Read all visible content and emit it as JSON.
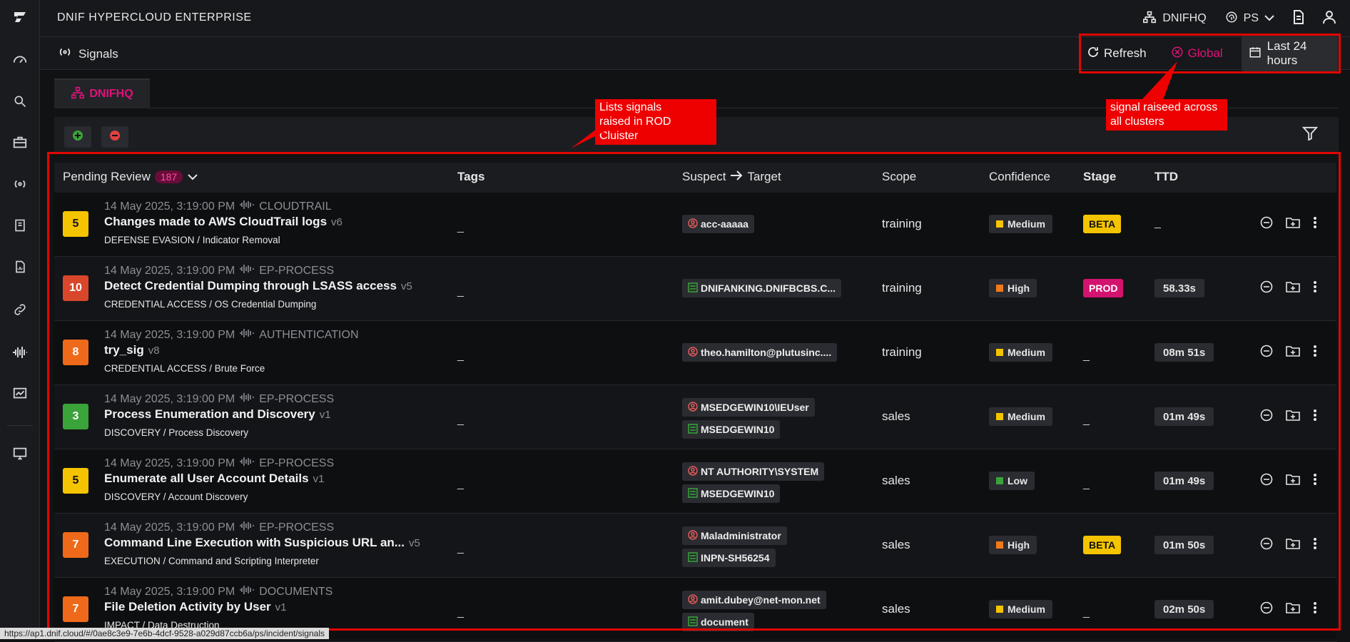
{
  "app": {
    "title": "DNIF HYPERCLOUD ENTERPRISE"
  },
  "topbar": {
    "cluster_label": "DNIFHQ",
    "user_short": "PS"
  },
  "page": {
    "title": "Signals"
  },
  "actions": {
    "refresh": "Refresh",
    "global": "Global",
    "time_range": "Last 24 hours"
  },
  "tabs": [
    {
      "label": "DNIFHQ"
    }
  ],
  "annotations": {
    "cluster_note": "Lists signals\nraised in ROD Cluister",
    "global_note": "signal raiseed across\n all clusters"
  },
  "table": {
    "status_filter": "Pending Review",
    "pending_count": "187",
    "headers": {
      "tags": "Tags",
      "suspect": "Suspect",
      "target": "Target",
      "scope": "Scope",
      "confidence": "Confidence",
      "stage": "Stage",
      "ttd": "TTD"
    },
    "rows": [
      {
        "severity": "5",
        "sev_color": "#f5c400",
        "sev_text": "#111",
        "timestamp": "14 May 2025, 3:19:00 PM",
        "source": "CLOUDTRAIL",
        "name": "Changes made to AWS CloudTrail logs",
        "version": "v6",
        "tactic": "DEFENSE EVASION / Indicator Removal",
        "tags": "_",
        "entities": [
          {
            "type": "user",
            "label": "acc-aaaaa"
          }
        ],
        "scope": "training",
        "confidence": "Medium",
        "conf_color": "#f5c400",
        "stage": "BETA",
        "stage_bg": "#f5c400",
        "stage_fg": "#111",
        "ttd": "_"
      },
      {
        "severity": "10",
        "sev_color": "#d9472b",
        "sev_text": "#fff",
        "timestamp": "14 May 2025, 3:19:00 PM",
        "source": "EP-PROCESS",
        "name": "Detect Credential Dumping through LSASS access",
        "version": "v5",
        "tactic": "CREDENTIAL ACCESS / OS Credential Dumping",
        "tags": "_",
        "entities": [
          {
            "type": "host",
            "label": "DNIFANKING.DNIFBCBS.C..."
          }
        ],
        "scope": "training",
        "confidence": "High",
        "conf_color": "#f07a1a",
        "stage": "PROD",
        "stage_bg": "#d4126f",
        "stage_fg": "#fff",
        "ttd": "58.33s"
      },
      {
        "severity": "8",
        "sev_color": "#ee6a1a",
        "sev_text": "#fff",
        "timestamp": "14 May 2025, 3:19:00 PM",
        "source": "AUTHENTICATION",
        "name": "try_sig",
        "version": "v8",
        "tactic": "CREDENTIAL ACCESS / Brute Force",
        "tags": "_",
        "entities": [
          {
            "type": "user",
            "label": "theo.hamilton@plutusinc...."
          }
        ],
        "scope": "training",
        "confidence": "Medium",
        "conf_color": "#f5c400",
        "stage": "_",
        "stage_bg": "",
        "stage_fg": "#ccc",
        "ttd": "08m 51s"
      },
      {
        "severity": "3",
        "sev_color": "#3aa33a",
        "sev_text": "#fff",
        "timestamp": "14 May 2025, 3:19:00 PM",
        "source": "EP-PROCESS",
        "name": "Process Enumeration and Discovery",
        "version": "v1",
        "tactic": "DISCOVERY / Process Discovery",
        "tags": "_",
        "entities": [
          {
            "type": "user",
            "label": "MSEDGEWIN10\\IEUser"
          },
          {
            "type": "host",
            "label": "MSEDGEWIN10"
          }
        ],
        "scope": "sales",
        "confidence": "Medium",
        "conf_color": "#f5c400",
        "stage": "_",
        "stage_bg": "",
        "stage_fg": "#ccc",
        "ttd": "01m 49s"
      },
      {
        "severity": "5",
        "sev_color": "#f5c400",
        "sev_text": "#111",
        "timestamp": "14 May 2025, 3:19:00 PM",
        "source": "EP-PROCESS",
        "name": "Enumerate all User Account Details",
        "version": "v1",
        "tactic": "DISCOVERY / Account Discovery",
        "tags": "_",
        "entities": [
          {
            "type": "user",
            "label": "NT AUTHORITY\\SYSTEM"
          },
          {
            "type": "host",
            "label": "MSEDGEWIN10"
          }
        ],
        "scope": "sales",
        "confidence": "Low",
        "conf_color": "#3aa33a",
        "stage": "_",
        "stage_bg": "",
        "stage_fg": "#ccc",
        "ttd": "01m 49s"
      },
      {
        "severity": "7",
        "sev_color": "#ee6a1a",
        "sev_text": "#fff",
        "timestamp": "14 May 2025, 3:19:00 PM",
        "source": "EP-PROCESS",
        "name": "Command Line Execution with Suspicious URL an...",
        "version": "v5",
        "tactic": "EXECUTION / Command and Scripting Interpreter",
        "tags": "_",
        "entities": [
          {
            "type": "user",
            "label": "Maladministrator"
          },
          {
            "type": "host",
            "label": "INPN-SH56254"
          }
        ],
        "scope": "sales",
        "confidence": "High",
        "conf_color": "#f07a1a",
        "stage": "BETA",
        "stage_bg": "#f5c400",
        "stage_fg": "#111",
        "ttd": "01m 50s"
      },
      {
        "severity": "7",
        "sev_color": "#ee6a1a",
        "sev_text": "#fff",
        "timestamp": "14 May 2025, 3:19:00 PM",
        "source": "DOCUMENTS",
        "name": "File Deletion Activity by User",
        "version": "v1",
        "tactic": "IMPACT / Data Destruction",
        "tags": "_",
        "entities": [
          {
            "type": "user",
            "label": "amit.dubey@net-mon.net"
          },
          {
            "type": "host",
            "label": "document"
          }
        ],
        "scope": "sales",
        "confidence": "Medium",
        "conf_color": "#f5c400",
        "stage": "_",
        "stage_bg": "",
        "stage_fg": "#ccc",
        "ttd": "02m 50s"
      }
    ]
  },
  "status_url": "https://ap1.dnif.cloud/#/0ae8c3e9-7e6b-4dcf-9528-a029d87ccb6a/ps/incident/signals"
}
